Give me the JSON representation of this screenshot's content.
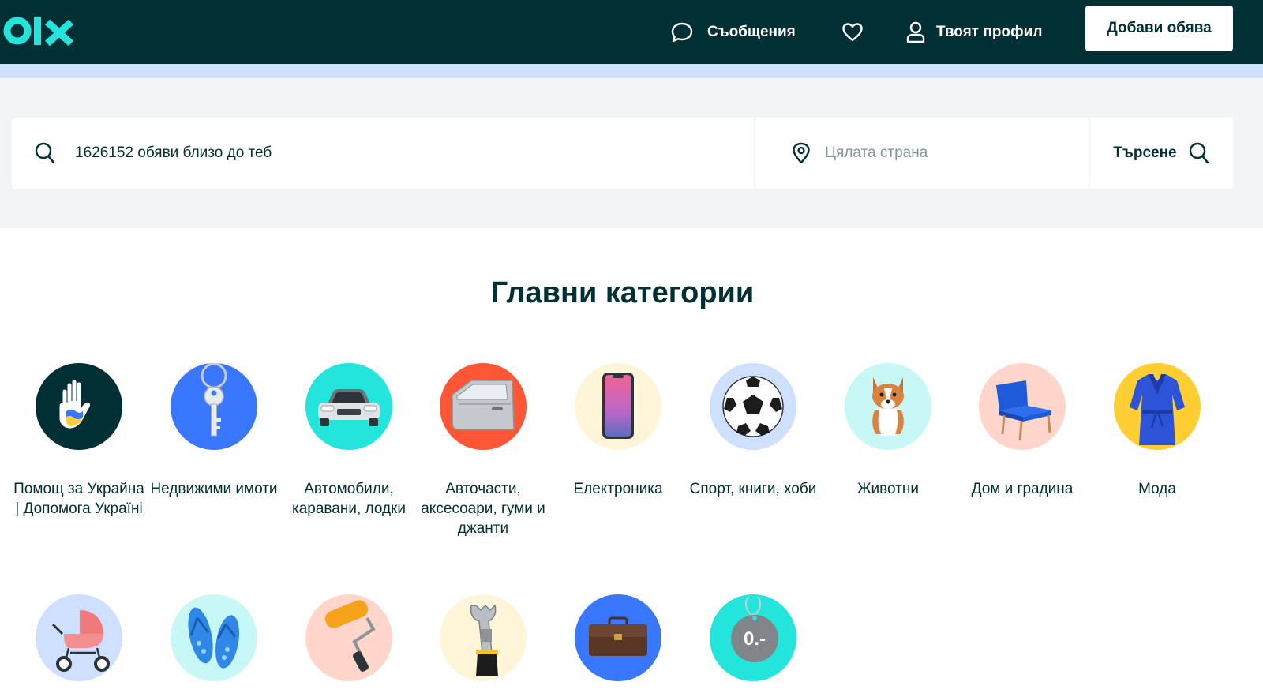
{
  "header": {
    "messages_label": "Съобщения",
    "profile_label": "Твоят профил",
    "add_ad_label": "Добави обява"
  },
  "search": {
    "query_placeholder": "1626152 обяви близо до теб",
    "location_placeholder": "Цялата страна",
    "button_label": "Търсене"
  },
  "categories": {
    "title": "Главни категории",
    "items": [
      {
        "label": "Помощ за Украйна | Допомога Україні",
        "icon": "ukraine-help-hand-icon",
        "bg": "#002f34"
      },
      {
        "label": "Недвижими имоти",
        "icon": "key-icon",
        "bg": "#3a77ff"
      },
      {
        "label": "Автомобили, каравани, лодки",
        "icon": "car-icon",
        "bg": "#23e5db"
      },
      {
        "label": "Авточасти, аксесоари, гуми и джанти",
        "icon": "car-door-icon",
        "bg": "#ff5636"
      },
      {
        "label": "Електроника",
        "icon": "smartphone-icon",
        "bg": "#fff6d9"
      },
      {
        "label": "Спорт, книги, хоби",
        "icon": "football-icon",
        "bg": "#cfdfff"
      },
      {
        "label": "Животни",
        "icon": "dog-icon",
        "bg": "#c8f8f6"
      },
      {
        "label": "Дом и градина",
        "icon": "armchair-icon",
        "bg": "#ffd6c9"
      },
      {
        "label": "Мода",
        "icon": "dress-icon",
        "bg": "#ffce32"
      },
      {
        "label": "",
        "icon": "baby-stroller-icon",
        "bg": "#cfdfff"
      },
      {
        "label": "",
        "icon": "flip-flops-icon",
        "bg": "#c8f8f6"
      },
      {
        "label": "",
        "icon": "paint-roller-icon",
        "bg": "#ffd6c9"
      },
      {
        "label": "",
        "icon": "wrench-icon",
        "bg": "#fff6d9"
      },
      {
        "label": "",
        "icon": "briefcase-icon",
        "bg": "#3a77ff"
      },
      {
        "label": "",
        "icon": "price-tag-icon",
        "bg": "#23e5db"
      }
    ]
  },
  "colors": {
    "brand_dark": "#002f34",
    "brand_accent": "#23e5db",
    "stripe": "#cfdfff",
    "band": "#f2f4f5"
  }
}
